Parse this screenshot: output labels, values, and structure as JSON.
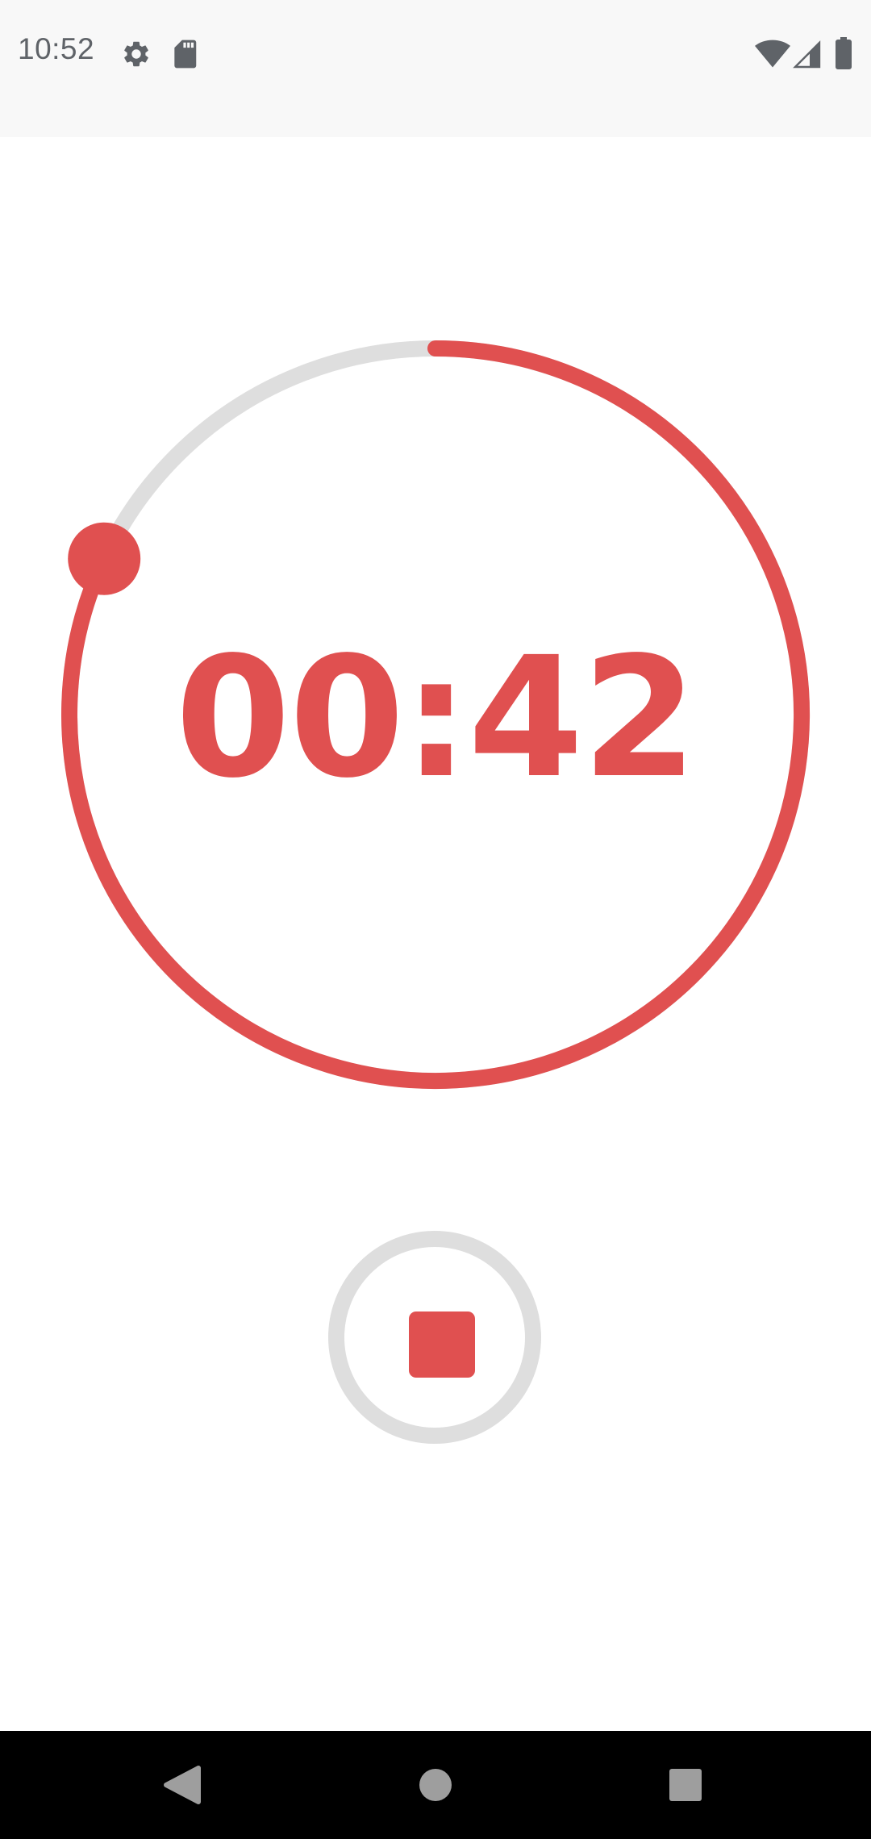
{
  "status_bar": {
    "time": "10:52",
    "icons_left": [
      "gear-icon",
      "sd-card-icon"
    ],
    "icons_right": [
      "wifi-icon",
      "cellular-signal-icon",
      "battery-icon"
    ]
  },
  "timer": {
    "display": "00:42",
    "progress_fraction": 0.82,
    "accent_color": "#e05050",
    "track_color": "#dedede"
  },
  "controls": {
    "stop_button_icon": "stop-icon"
  },
  "navigation": {
    "buttons": [
      "back-icon",
      "home-icon",
      "recents-icon"
    ]
  }
}
